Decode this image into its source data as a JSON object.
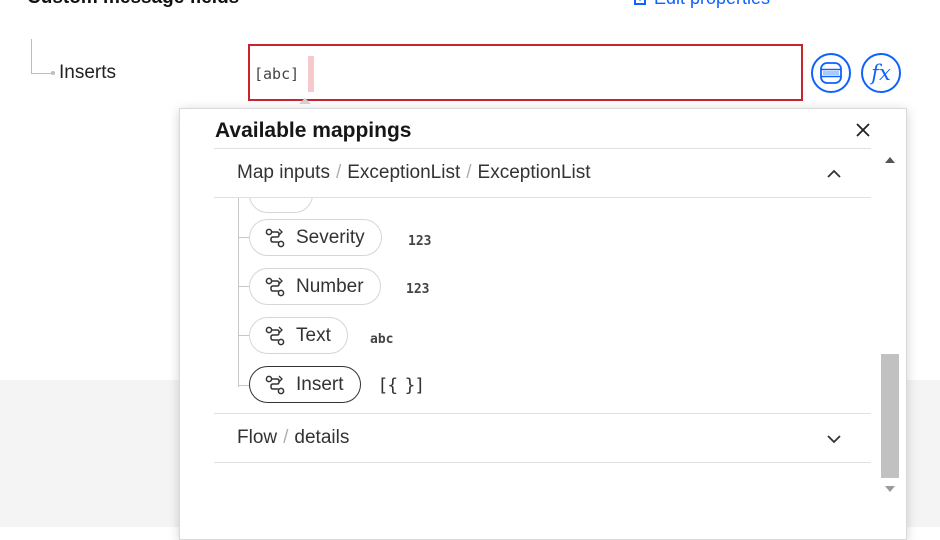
{
  "header": {
    "section_title": "Custom message fields",
    "edit_link": "Edit properties"
  },
  "field": {
    "label": "Inserts",
    "type_chip": "[abc]",
    "value": ""
  },
  "buttons": {
    "fx_label": "fx"
  },
  "panel": {
    "title": "Available mappings",
    "accordions": [
      {
        "crumbs": [
          "Map inputs",
          "ExceptionList",
          "ExceptionList"
        ],
        "expanded": true
      },
      {
        "crumbs": [
          "Flow",
          "details"
        ],
        "expanded": false
      }
    ],
    "items": [
      {
        "label": "Severity",
        "type": "123",
        "selected": false
      },
      {
        "label": "Number",
        "type": "123",
        "selected": false
      },
      {
        "label": "Text",
        "type": "abc",
        "selected": false
      },
      {
        "label": "Insert",
        "type": "[{ }]",
        "selected": true
      }
    ]
  },
  "colors": {
    "accent": "#0f62fe",
    "error_border": "#c8242f",
    "cursor_highlight": "#f6c9cd"
  },
  "icons": {
    "edit": "edit-properties-icon",
    "mapping": "data-map-icon",
    "function": "fx-icon",
    "close": "close-icon",
    "chevron_up": "chevron-up-icon",
    "chevron_down": "chevron-down-icon",
    "field": "flow-connection-icon"
  }
}
